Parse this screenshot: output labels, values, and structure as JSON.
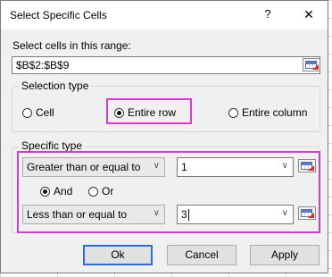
{
  "window": {
    "title": "Select Specific Cells",
    "help_glyph": "?",
    "close_glyph": "✕"
  },
  "range": {
    "label": "Select cells in this range:",
    "value": "$B$2:$B$9"
  },
  "selection_type": {
    "legend": "Selection type",
    "options": [
      "Cell",
      "Entire row",
      "Entire column"
    ],
    "selected": "Entire row"
  },
  "specific_type": {
    "legend": "Specific type",
    "condition1": {
      "operator": "Greater than or equal to",
      "value": "1"
    },
    "logic": {
      "options": [
        "And",
        "Or"
      ],
      "selected": "And"
    },
    "condition2": {
      "operator": "Less than or equal to",
      "value": "3"
    }
  },
  "buttons": {
    "ok": "Ok",
    "cancel": "Cancel",
    "apply": "Apply"
  },
  "colors": {
    "highlight": "#d63bd6",
    "default_button_border": "#2f6fd1"
  },
  "icons": {
    "range_picker": "range-select-icon",
    "dropdown": "chevron-down-icon"
  }
}
